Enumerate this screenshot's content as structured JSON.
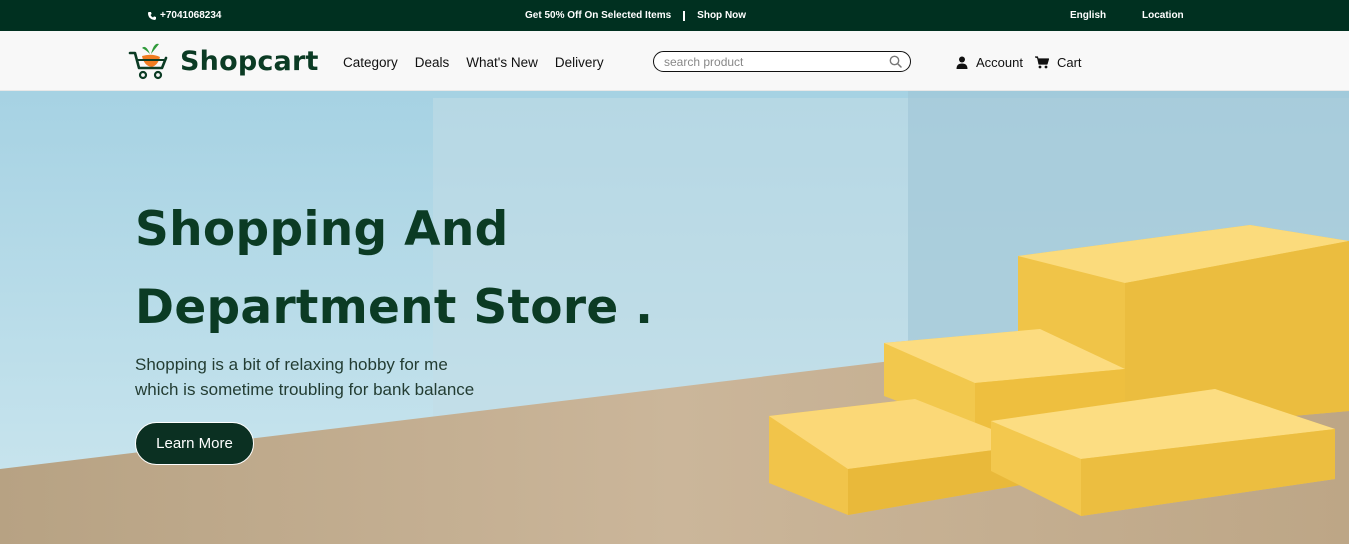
{
  "topbar": {
    "phone": "+7041068234",
    "promo_text": "Get 50% Off On Selected Items",
    "promo_link": "Shop Now",
    "language": "English",
    "location": "Location"
  },
  "header": {
    "brand": "Shopcart",
    "nav": [
      "Category",
      "Deals",
      "What's New",
      "Delivery"
    ],
    "search_placeholder": "search product",
    "account_label": "Account",
    "cart_label": "Cart"
  },
  "hero": {
    "title_line1": "Shopping And",
    "title_line2": "Department Store .",
    "subtitle_line1": "Shopping is a bit of relaxing hobby for me",
    "subtitle_line2": "which is sometime troubling for bank balance",
    "cta_label": "Learn More"
  },
  "colors": {
    "topbar_bg": "#003020",
    "brand_green": "#0b3b24",
    "sky": "#a9d4e4",
    "floor": "#bfa98c",
    "box_yellow": "#f2c94c"
  }
}
